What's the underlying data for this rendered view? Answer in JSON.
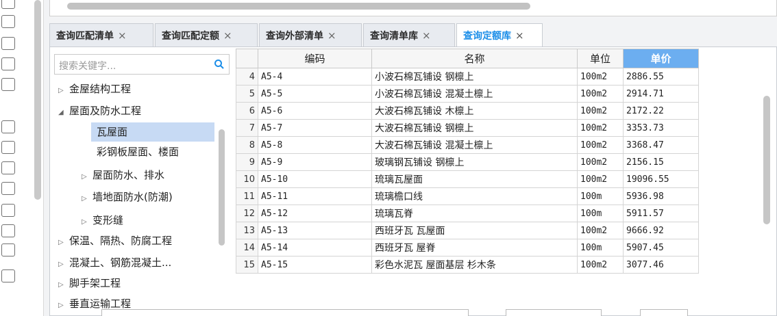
{
  "tabs": [
    {
      "label": "查询匹配清单",
      "close": "×"
    },
    {
      "label": "查询匹配定额",
      "close": "×"
    },
    {
      "label": "查询外部清单",
      "close": "×"
    },
    {
      "label": "查询清单库",
      "close": "×"
    },
    {
      "label": "查询定额库",
      "close": "×",
      "active": true
    }
  ],
  "search": {
    "placeholder": "搜索关键字..."
  },
  "tree": [
    {
      "label": "金屋结构工程",
      "arrow": "▷"
    },
    {
      "label": "屋面及防水工程",
      "arrow": "◢"
    },
    {
      "label": "瓦屋面",
      "arrow": "",
      "selected": true
    },
    {
      "label": "彩钢板屋面、楼面",
      "arrow": ""
    },
    {
      "label": "屋面防水、排水",
      "arrow": "▷"
    },
    {
      "label": "墙地面防水(防潮)",
      "arrow": "▷"
    },
    {
      "label": "变形缝",
      "arrow": "▷"
    },
    {
      "label": "保温、隔热、防腐工程",
      "arrow": "▷"
    },
    {
      "label": "混凝土、钢筋混凝土...",
      "arrow": "▷"
    },
    {
      "label": "脚手架工程",
      "arrow": "▷"
    },
    {
      "label": "垂直运输工程",
      "arrow": "▷"
    }
  ],
  "grid": {
    "headers": {
      "code": "编码",
      "name": "名称",
      "unit": "单位",
      "price": "单价"
    },
    "rows": [
      {
        "n": "4",
        "code": "A5-4",
        "name": "小波石棉瓦铺设 钢檩上",
        "unit": "100m2",
        "price": "2886.55"
      },
      {
        "n": "5",
        "code": "A5-5",
        "name": "小波石棉瓦铺设 混凝土檩上",
        "unit": "100m2",
        "price": "2914.71"
      },
      {
        "n": "6",
        "code": "A5-6",
        "name": "大波石棉瓦铺设 木檩上",
        "unit": "100m2",
        "price": "2172.22"
      },
      {
        "n": "7",
        "code": "A5-7",
        "name": "大波石棉瓦铺设 钢檩上",
        "unit": "100m2",
        "price": "3353.73"
      },
      {
        "n": "8",
        "code": "A5-8",
        "name": "大波石棉瓦铺设 混凝土檩上",
        "unit": "100m2",
        "price": "3368.47"
      },
      {
        "n": "9",
        "code": "A5-9",
        "name": "玻璃钢瓦铺设 钢檩上",
        "unit": "100m2",
        "price": "2156.15"
      },
      {
        "n": "10",
        "code": "A5-10",
        "name": "琉璃瓦屋面",
        "unit": "100m2",
        "price": "19096.55"
      },
      {
        "n": "11",
        "code": "A5-11",
        "name": "琉璃檐口线",
        "unit": "100m",
        "price": "5936.98"
      },
      {
        "n": "12",
        "code": "A5-12",
        "name": "琉璃瓦脊",
        "unit": "100m",
        "price": "5911.57"
      },
      {
        "n": "13",
        "code": "A5-13",
        "name": "西班牙瓦 瓦屋面",
        "unit": "100m2",
        "price": "9666.92"
      },
      {
        "n": "14",
        "code": "A5-14",
        "name": "西班牙瓦 屋脊",
        "unit": "100m",
        "price": "5907.45"
      },
      {
        "n": "15",
        "code": "A5-15",
        "name": "彩色水泥瓦 屋面基层 杉木条",
        "unit": "100m2",
        "price": "3077.46"
      }
    ]
  },
  "colors": {
    "accent": "#1c8ee8",
    "price_header": "#6caef0",
    "selected": "#c7daf4"
  },
  "icons": {
    "search": "search-icon",
    "tree_collapsed": "caret-right-icon",
    "tree_expanded": "caret-down-icon"
  }
}
